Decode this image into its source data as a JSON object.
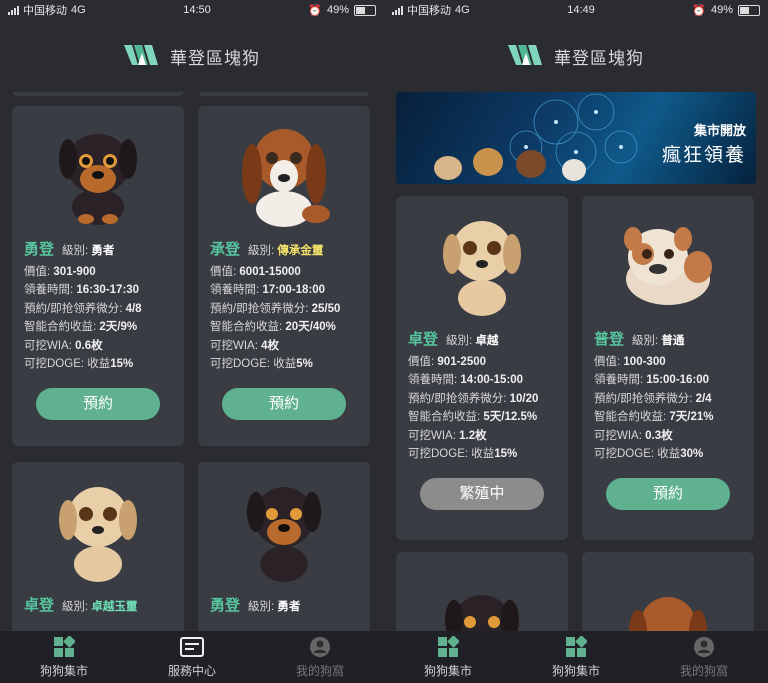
{
  "status": {
    "left": {
      "carrier": "中国移动",
      "network": "4G",
      "time": "14:50",
      "battery": "49%"
    },
    "right": {
      "carrier": "中国移动",
      "network": "4G",
      "time": "14:49",
      "battery": "49%"
    }
  },
  "app": {
    "title": "華登區塊狗"
  },
  "labels": {
    "level": "級別:",
    "price": "價值:",
    "time": "領養時間:",
    "reserve": "預約/即抢领养微分:",
    "contract": "智能合約收益:",
    "wia": "可挖WIA:",
    "doge": "可挖DOGE:",
    "yield": "收益"
  },
  "left_cards": [
    {
      "name": "勇登",
      "level": "勇者",
      "level_color": "#ffffff",
      "price": "301-900",
      "time": "16:30-17:30",
      "reserve": "4/8",
      "contract": "2天/9%",
      "wia": "0.6枚",
      "doge": "15%",
      "button": "預約",
      "coat": "rottweiler"
    },
    {
      "name": "承登",
      "level": "傳承金璽",
      "level_color": "#f3e36b",
      "price": "6001-15000",
      "time": "17:00-18:00",
      "reserve": "25/50",
      "contract": "20天/40%",
      "wia": "4枚",
      "doge": "5%",
      "button": "預約",
      "coat": "basset"
    },
    {
      "name": "卓登",
      "level": "卓越玉璽",
      "level_color": "#6ee0b6",
      "coat": "lab"
    },
    {
      "name": "勇登",
      "level": "勇者",
      "level_color": "#ffffff",
      "coat": "rottweiler"
    }
  ],
  "banner": {
    "line1": "集市開放",
    "line2": "瘋狂領養"
  },
  "right_cards": [
    {
      "name": "卓登",
      "level": "卓越",
      "level_color": "#ffffff",
      "price": "901-2500",
      "time": "14:00-15:00",
      "reserve": "10/20",
      "contract": "5天/12.5%",
      "wia": "1.2枚",
      "doge": "15%",
      "button": "繁殖中",
      "busy": true,
      "coat": "lab"
    },
    {
      "name": "普登",
      "level": "普通",
      "level_color": "#ffffff",
      "price": "100-300",
      "time": "15:00-16:00",
      "reserve": "2/4",
      "contract": "7天/21%",
      "wia": "0.3枚",
      "doge": "30%",
      "button": "預約",
      "busy": false,
      "coat": "bulldog"
    }
  ],
  "tabs_left": [
    {
      "label": "狗狗集市",
      "state": "normal",
      "icon": "grid-icon"
    },
    {
      "label": "服務中心",
      "state": "active",
      "icon": "card-icon"
    },
    {
      "label": "我的狗窩",
      "state": "dim",
      "icon": "user-icon"
    }
  ],
  "tabs_right": [
    {
      "label": "狗狗集市",
      "state": "normal",
      "icon": "grid-icon"
    },
    {
      "label": "狗狗集市",
      "state": "normal",
      "icon": "grid-icon"
    },
    {
      "label": "我的狗窩",
      "state": "dim",
      "icon": "user-icon"
    }
  ]
}
